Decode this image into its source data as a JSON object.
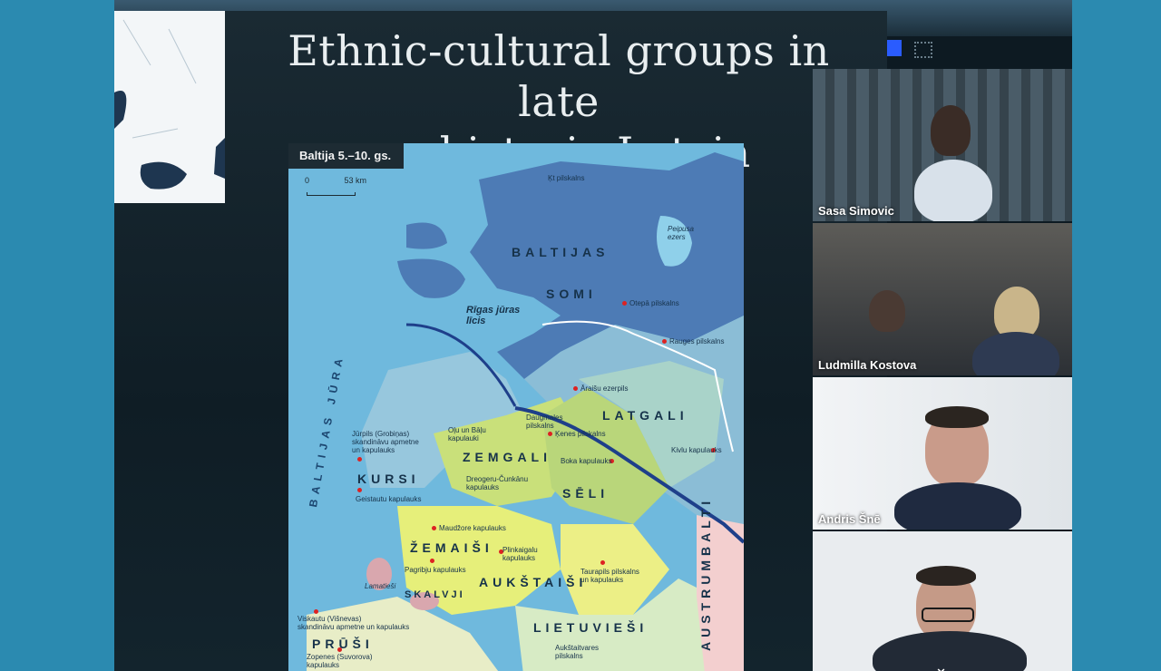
{
  "slide": {
    "title_line1": "Ethnic-cultural groups in late",
    "title_line2": "prehistoric Latvia"
  },
  "map": {
    "badge": "Baltija 5.–10. gs.",
    "scale_start": "0",
    "scale_end": "53 km",
    "regions": {
      "baltijas": "BALTIJAS",
      "somi": "SOMI",
      "latgali": "LATGALI",
      "zemgali": "ZEMGALI",
      "seli": "SĒLI",
      "kursi": "KURSI",
      "zemaisi": "ŽEMAIŠI",
      "aukstaisi": "AUKŠTAIŠI",
      "lietuviesi": "LIETUVIEŠI",
      "skalvji": "SKALVJI",
      "prusi": "PRŪŠI",
      "austrumbalti": "AUSTRUMBALTI",
      "baltijas_jura": "BALTIJAS JŪRA",
      "lamatiesi": "Lamatieši"
    },
    "places": {
      "rigas_juras_licis": "Rīgas jūras\nlīcis",
      "peipusa_ezers": "Peipusa\nezers",
      "otepa": "Otepā pilskalns",
      "rauges": "Rauges pilskalns",
      "araisu": "Āraišu ezerpils",
      "daugmales": "Daugmales\npilskalns",
      "kenes": "Ķenes pilskalns",
      "olu_balu": "Oļu un Bāļu\nkapulauki",
      "jurpils": "Jūrpils (Grobiņas)\nskandināvu apmetne\nun kapulauks",
      "dreogeru": "Dreogeru-Čunkānu\nkapulauks",
      "boka": "Boka kapulauks",
      "kivlu": "Kivlu kapulauks",
      "geistautu": "Geistautu kapulauks",
      "maudzore": "Maudžore kapulauks",
      "pagribju": "Pagribju kapulauks",
      "plinkaigalu": "Plinkaigalu\nkapulauks",
      "taurapils": "Taurapils pilskalns\nun kapulauks",
      "viskautu": "Viskautu (Višnevas)\nskandināvu apmetne un kapulauks",
      "zopenes": "Zopenes (Suvorova)\nkapulauks",
      "aukstaitu": "Aukštaitvares\npilskalns",
      "kapsala": "Ķt pilskalns"
    }
  },
  "participants": [
    {
      "name": "Sasa Simovic",
      "active": false
    },
    {
      "name": "Ludmilla Kostova",
      "active": false
    },
    {
      "name": "Andris Šnē",
      "active": true
    },
    {
      "name": "",
      "active": false
    }
  ],
  "colors": {
    "active_speaker": "#58c04a",
    "background": "#2b8ab0"
  }
}
